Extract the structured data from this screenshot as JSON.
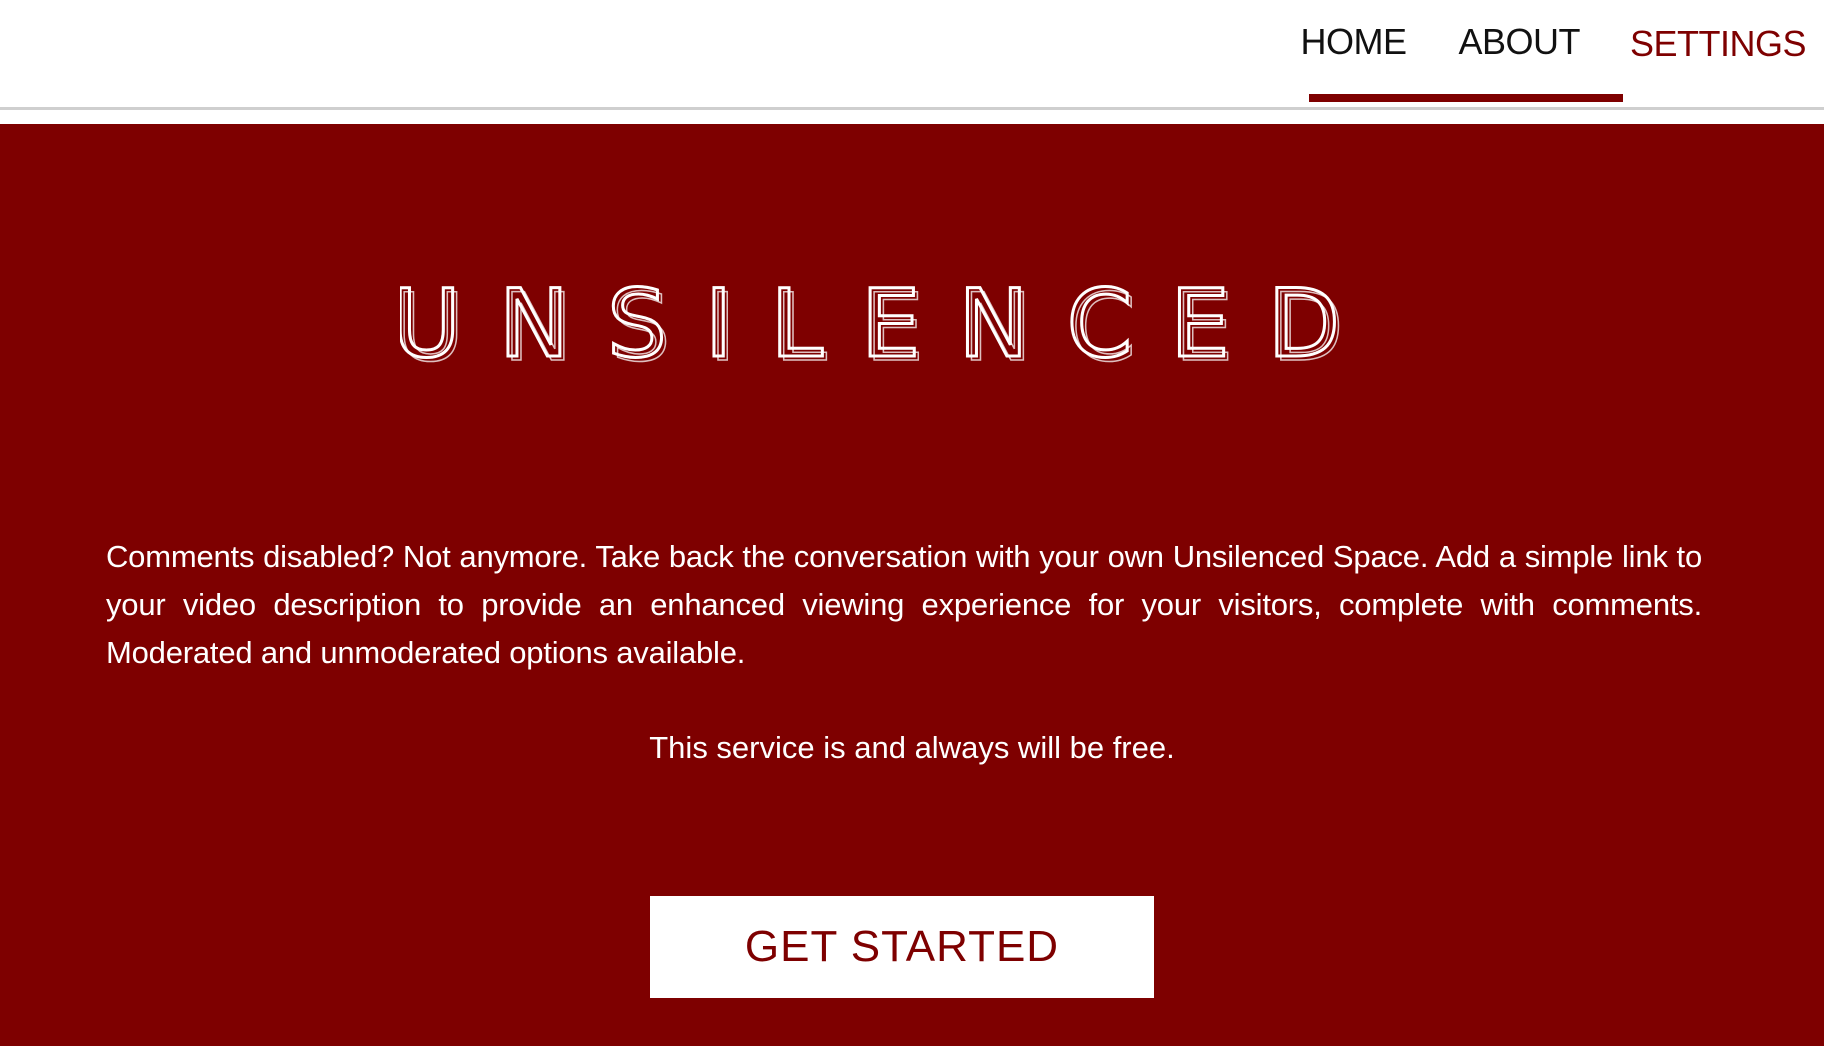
{
  "nav": {
    "items": [
      {
        "label": "HOME"
      },
      {
        "label": "ABOUT"
      },
      {
        "label": "SETTINGS"
      }
    ]
  },
  "hero": {
    "logo_text": "UNSILENCED",
    "description": "Comments disabled? Not anymore. Take back the conversation with your own Unsilenced Space. Add a simple link to your video description to provide an enhanced viewing experience for your visitors, complete with comments. Moderated and unmoderated options available.",
    "free_note": "This service is and always will be free.",
    "cta_label": "GET STARTED"
  },
  "colors": {
    "brand": "#7e0000",
    "text_on_brand": "#ffffff",
    "nav_text": "#111111",
    "header_bg": "#ffffff"
  }
}
